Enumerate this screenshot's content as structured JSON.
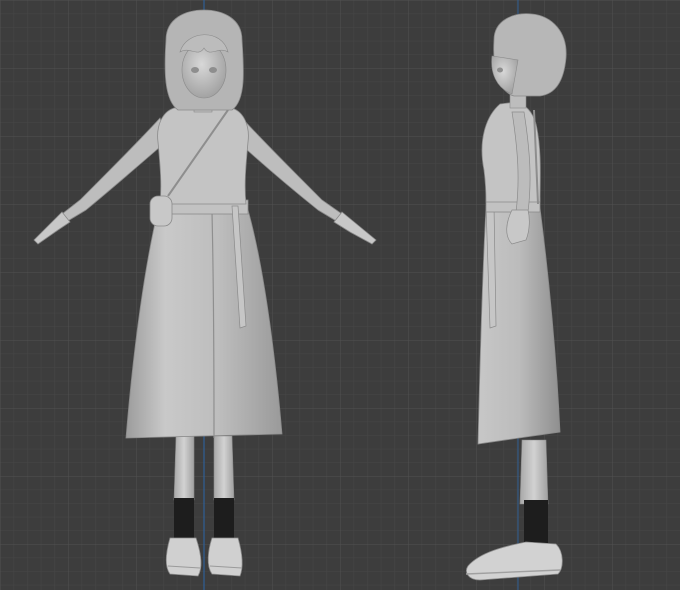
{
  "viewport": {
    "background": "#3d3d3d",
    "grid_minor_color": "#474747",
    "grid_major_color": "#4f4f4f",
    "axis_line_color": "#2f5f96"
  },
  "models": [
    {
      "view": "front"
    },
    {
      "view": "side"
    }
  ],
  "material": {
    "clay_light": "#cfcfcf",
    "clay_mid": "#a9a9a9",
    "clay_dark": "#7e7e7e",
    "socks": "#1d1d1d"
  }
}
